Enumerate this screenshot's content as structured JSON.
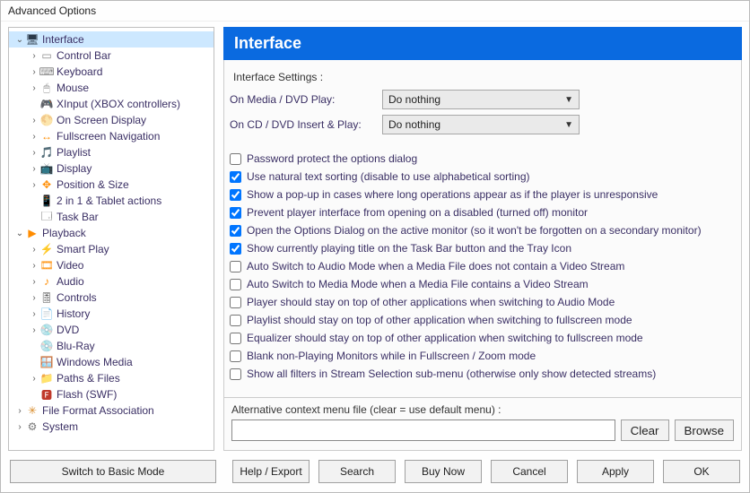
{
  "window_title": "Advanced Options",
  "tree": [
    {
      "depth": 0,
      "caret": "down",
      "icon": "monitor",
      "label": "Interface",
      "selected": true
    },
    {
      "depth": 1,
      "caret": "right",
      "icon": "controlbar",
      "label": "Control Bar"
    },
    {
      "depth": 1,
      "caret": "right",
      "icon": "keyboard",
      "label": "Keyboard"
    },
    {
      "depth": 1,
      "caret": "right",
      "icon": "mouse",
      "label": "Mouse"
    },
    {
      "depth": 1,
      "caret": "",
      "icon": "gamepad",
      "label": "XInput (XBOX controllers)"
    },
    {
      "depth": 1,
      "caret": "right",
      "icon": "osd",
      "label": "On Screen Display"
    },
    {
      "depth": 1,
      "caret": "right",
      "icon": "fullnav",
      "label": "Fullscreen Navigation"
    },
    {
      "depth": 1,
      "caret": "right",
      "icon": "playlist",
      "label": "Playlist"
    },
    {
      "depth": 1,
      "caret": "right",
      "icon": "display",
      "label": "Display"
    },
    {
      "depth": 1,
      "caret": "right",
      "icon": "position",
      "label": "Position & Size"
    },
    {
      "depth": 1,
      "caret": "",
      "icon": "tablet",
      "label": "2 in 1 & Tablet actions"
    },
    {
      "depth": 1,
      "caret": "",
      "icon": "taskbar",
      "label": "Task Bar"
    },
    {
      "depth": 0,
      "caret": "down",
      "icon": "playback",
      "label": "Playback"
    },
    {
      "depth": 1,
      "caret": "right",
      "icon": "smartplay",
      "label": "Smart Play"
    },
    {
      "depth": 1,
      "caret": "right",
      "icon": "video",
      "label": "Video"
    },
    {
      "depth": 1,
      "caret": "right",
      "icon": "audio",
      "label": "Audio"
    },
    {
      "depth": 1,
      "caret": "right",
      "icon": "controls",
      "label": "Controls"
    },
    {
      "depth": 1,
      "caret": "right",
      "icon": "history",
      "label": "History"
    },
    {
      "depth": 1,
      "caret": "right",
      "icon": "dvd",
      "label": "DVD"
    },
    {
      "depth": 1,
      "caret": "",
      "icon": "bluray",
      "label": "Blu-Ray"
    },
    {
      "depth": 1,
      "caret": "",
      "icon": "wmedia",
      "label": "Windows Media"
    },
    {
      "depth": 1,
      "caret": "right",
      "icon": "paths",
      "label": "Paths & Files"
    },
    {
      "depth": 1,
      "caret": "",
      "icon": "flash",
      "label": "Flash (SWF)"
    },
    {
      "depth": 0,
      "caret": "right",
      "icon": "fileassoc",
      "label": "File Format Association"
    },
    {
      "depth": 0,
      "caret": "right",
      "icon": "system",
      "label": "System"
    }
  ],
  "header": "Interface",
  "group_label": "Interface Settings :",
  "settings": {
    "mediaplay": {
      "label": "On Media / DVD Play:",
      "value": "Do nothing"
    },
    "cdplay": {
      "label": "On CD / DVD Insert & Play:",
      "value": "Do nothing"
    }
  },
  "checks": [
    {
      "checked": false,
      "label": "Password protect the options dialog"
    },
    {
      "checked": true,
      "label": "Use natural text sorting (disable to use alphabetical sorting)"
    },
    {
      "checked": true,
      "label": "Show a pop-up in cases where long operations appear as if the player is unresponsive"
    },
    {
      "checked": true,
      "label": "Prevent player interface from opening on a disabled (turned off) monitor"
    },
    {
      "checked": true,
      "label": "Open the Options Dialog on the active monitor (so it won't be forgotten on a secondary monitor)"
    },
    {
      "checked": true,
      "label": "Show currently playing title on the Task Bar button and the Tray Icon"
    },
    {
      "checked": false,
      "label": "Auto Switch to Audio Mode when a Media File does not contain a Video Stream"
    },
    {
      "checked": false,
      "label": "Auto Switch to Media Mode when a Media File contains a Video Stream"
    },
    {
      "checked": false,
      "label": "Player should stay on top of other applications when switching to Audio Mode"
    },
    {
      "checked": false,
      "label": "Playlist should stay on top of other application when switching to fullscreen mode"
    },
    {
      "checked": false,
      "label": "Equalizer should stay on top of other application when switching to fullscreen mode"
    },
    {
      "checked": false,
      "label": "Blank non-Playing Monitors while in Fullscreen / Zoom mode"
    },
    {
      "checked": false,
      "label": "Show all filters in Stream Selection sub-menu (otherwise only show detected streams)"
    }
  ],
  "alt_menu": {
    "label": "Alternative context menu file (clear = use default menu) :",
    "value": "",
    "clear": "Clear",
    "browse": "Browse"
  },
  "footer": {
    "basic": "Switch to Basic Mode",
    "help": "Help / Export",
    "search": "Search",
    "buy": "Buy Now",
    "cancel": "Cancel",
    "apply": "Apply",
    "ok": "OK"
  },
  "icon_glyphs": {
    "monitor": "🖥",
    "controlbar": "▭",
    "keyboard": "⌨",
    "mouse": "🖱",
    "gamepad": "🎮",
    "osd": "🌕",
    "fullnav": "↔",
    "playlist": "🎵",
    "display": "📺",
    "position": "✥",
    "tablet": "📱",
    "taskbar": "🗔",
    "playback": "▶",
    "smartplay": "⚡",
    "video": "🎞",
    "audio": "♪",
    "controls": "🎚",
    "history": "📄",
    "dvd": "💿",
    "bluray": "💿",
    "wmedia": "🪟",
    "paths": "📁",
    "flash": "🅵",
    "fileassoc": "✳",
    "system": "⚙"
  },
  "icon_colors": {
    "monitor": "#2b3a4a",
    "controlbar": "#8a8a8a",
    "keyboard": "#8a8a8a",
    "mouse": "#8a8a8a",
    "gamepad": "#444",
    "osd": "#ff8c00",
    "fullnav": "#ff8c00",
    "playlist": "#ff8c00",
    "display": "#444",
    "position": "#ff8c00",
    "tablet": "#ff8c00",
    "taskbar": "#444",
    "playback": "#ff8c00",
    "smartplay": "#ff8c00",
    "video": "#ff8c00",
    "audio": "#ff8c00",
    "controls": "#444",
    "history": "#d4c36a",
    "dvd": "#d9b54a",
    "bluray": "#3b64c7",
    "wmedia": "#3b64c7",
    "paths": "#d4a84a",
    "flash": "#c0392b",
    "fileassoc": "#d98c2b",
    "system": "#777"
  }
}
